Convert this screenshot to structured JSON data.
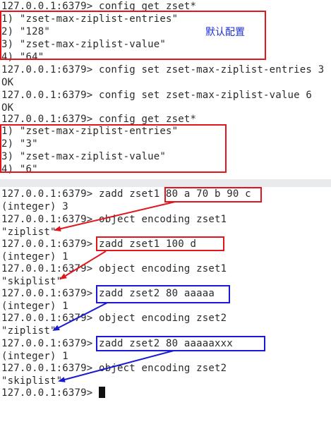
{
  "colors": {
    "red_box": "#e1161d",
    "blue_box": "#1a1ad6",
    "annotation_text": "#1d2fd6",
    "terminal_text": "#2a2a2a",
    "background": "#ffffff"
  },
  "annotation": {
    "default_config": "默认配置"
  },
  "top_panel": {
    "lines": [
      "127.0.0.1:6379> config get zset*",
      "1) \"zset-max-ziplist-entries\"",
      "2) \"128\"",
      "3) \"zset-max-ziplist-value\"",
      "4) \"64\"",
      "127.0.0.1:6379> config set zset-max-ziplist-entries 3",
      "OK",
      "127.0.0.1:6379> config set zset-max-ziplist-value 6",
      "OK",
      "127.0.0.1:6379> config get zset*",
      "1) \"zset-max-ziplist-entries\"",
      "2) \"3\"",
      "3) \"zset-max-ziplist-value\"",
      "4) \"6\""
    ]
  },
  "bottom_panel": {
    "lines": [
      "127.0.0.1:6379> zadd zset1 80 a 70 b 90 c",
      "(integer) 3",
      "127.0.0.1:6379> object encoding zset1",
      "\"ziplist\"",
      "127.0.0.1:6379> zadd zset1 100 d",
      "(integer) 1",
      "127.0.0.1:6379> object encoding zset1",
      "\"skiplist\"",
      "127.0.0.1:6379> zadd zset2 80 aaaaa",
      "(integer) 1",
      "127.0.0.1:6379> object encoding zset2",
      "\"ziplist\"",
      "127.0.0.1:6379> zadd zset2 80 aaaaaxxx",
      "(integer) 1",
      "127.0.0.1:6379> object encoding zset2",
      "\"skiplist\"",
      "127.0.0.1:6379> "
    ]
  }
}
